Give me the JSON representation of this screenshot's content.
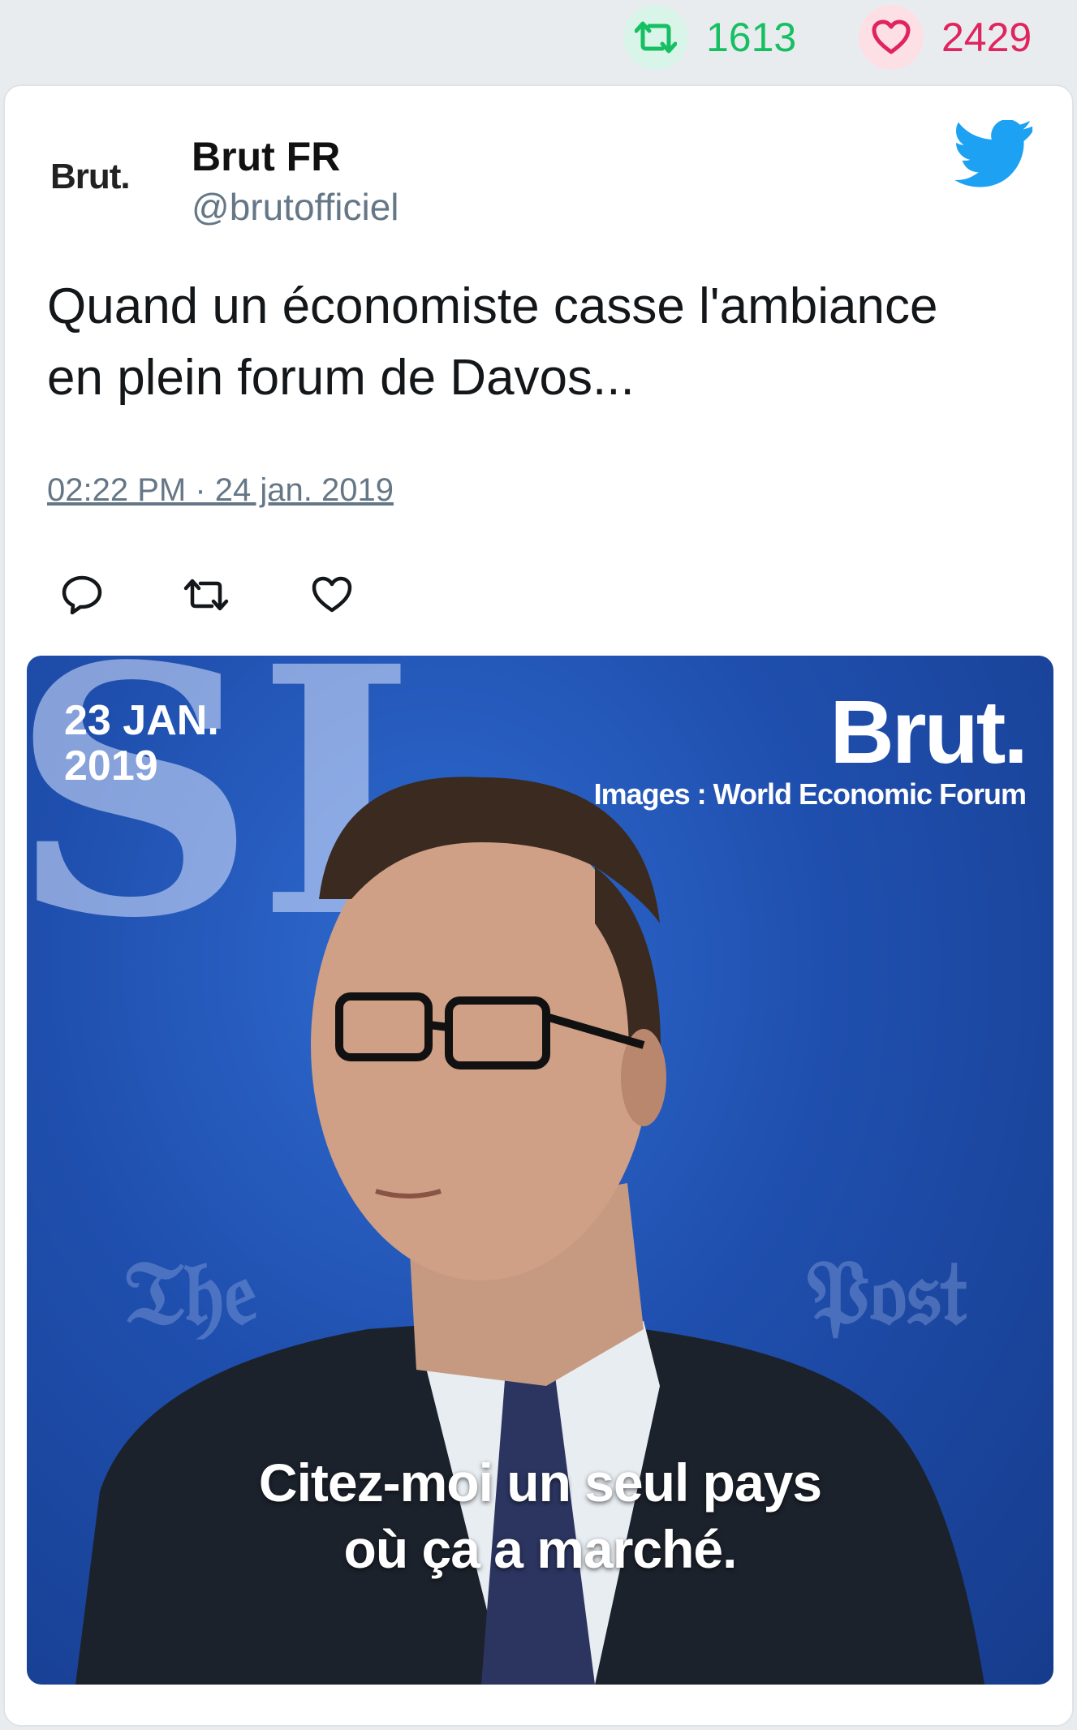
{
  "stats": {
    "retweets": "1613",
    "likes": "2429",
    "retweet_color": "#17bf63",
    "like_color": "#e0245e"
  },
  "tweet": {
    "avatar_text": "Brut.",
    "display_name": "Brut FR",
    "handle": "@brutofficiel",
    "text_line1": "Quand un économiste casse l'ambiance",
    "text_line2": "en plein forum de Davos...",
    "timestamp": "02:22 PM · 24 jan. 2019",
    "actions": [
      "reply-icon",
      "retweet-icon",
      "like-icon"
    ],
    "platform_icon": "twitter-bird-icon",
    "accent": "#1da1f2"
  },
  "media": {
    "date_line1": "23 JAN.",
    "date_line2": "2019",
    "brand": "Brut.",
    "credit": "Images : World Economic Forum",
    "subtitle_line1": "Citez-moi un seul pays",
    "subtitle_line2": "où ça a marché."
  }
}
